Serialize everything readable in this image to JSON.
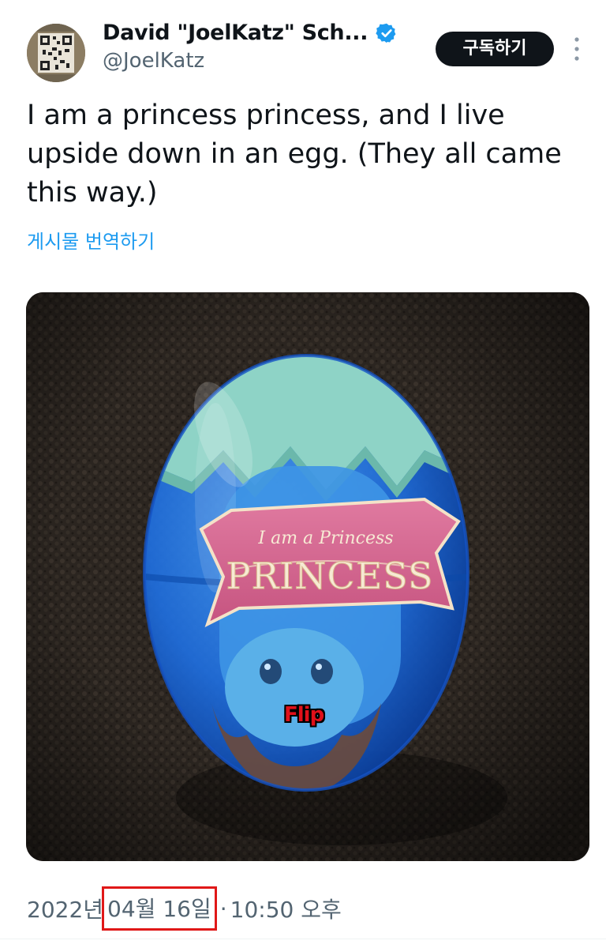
{
  "author": {
    "display_name": "David \"JoelKatz\" Sch...",
    "handle": "@JoelKatz",
    "verified": true,
    "avatar_icon": "qr-code-avatar"
  },
  "actions": {
    "subscribe_label": "구독하기",
    "more_icon": "more-vertical-icon"
  },
  "post": {
    "text": "I am a princess princess, and I live upside down in an egg. (They all came this way.)",
    "translate_label": "게시물 번역하기"
  },
  "media": {
    "banner_top": "I am a Princess",
    "banner_main": "PRINCESS",
    "caption": "Flip"
  },
  "timestamp": {
    "year": "2022년",
    "month_day": "04월 16일",
    "separator": "·",
    "time": "10:50 오후"
  },
  "colors": {
    "link": "#1d9bf0",
    "verified": "#1d9bf0",
    "button_bg": "#0f1419",
    "highlight_box": "#e01818"
  }
}
